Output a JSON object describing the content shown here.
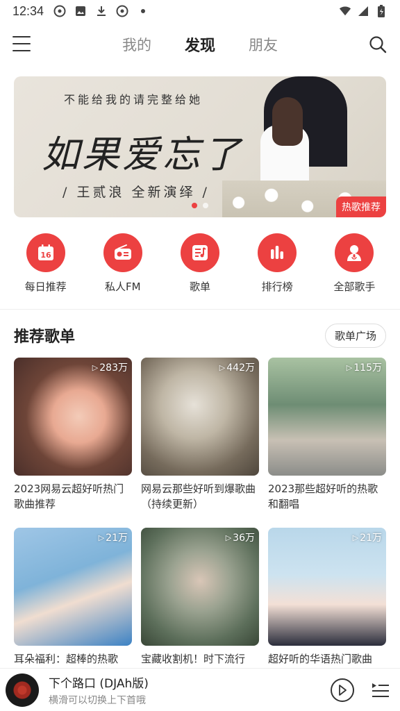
{
  "status_bar": {
    "time": "12:34",
    "left_icons": [
      "netease-icon",
      "image-icon",
      "download-icon",
      "netease-icon",
      "dot-icon"
    ],
    "right_icons": [
      "wifi-icon",
      "signal-icon",
      "battery-icon"
    ]
  },
  "nav": {
    "tabs": [
      {
        "label": "我的",
        "active": false
      },
      {
        "label": "发现",
        "active": true
      },
      {
        "label": "朋友",
        "active": false
      }
    ]
  },
  "banner": {
    "top_text": "不能给我的请完整给她",
    "title": "如果爱忘了",
    "subtitle": "/ 王贰浪  全新演绎 /",
    "tag": "热歌推荐",
    "dots": 2,
    "active_dot": 0
  },
  "quick_entries": [
    {
      "label": "每日推荐",
      "icon": "calendar-icon",
      "day": "16"
    },
    {
      "label": "私人FM",
      "icon": "radio-icon"
    },
    {
      "label": "歌单",
      "icon": "playlist-icon"
    },
    {
      "label": "排行榜",
      "icon": "chart-icon"
    },
    {
      "label": "全部歌手",
      "icon": "singer-icon"
    }
  ],
  "section": {
    "title": "推荐歌单",
    "more_label": "歌单广场"
  },
  "playlists": [
    {
      "count": "283万",
      "title": "2023网易云超好听热门歌曲推荐"
    },
    {
      "count": "442万",
      "title": "网易云那些好听到爆歌曲（持续更新）"
    },
    {
      "count": "115万",
      "title": "2023那些超好听的热歌和翻唱"
    },
    {
      "count": "21万",
      "title": "耳朵福利：超棒的热歌"
    },
    {
      "count": "36万",
      "title": "宝藏收割机！时下流行"
    },
    {
      "count": "21万",
      "title": "超好听的华语热门歌曲"
    }
  ],
  "player": {
    "song": "下个路口 (DJAh版)",
    "hint": "横滑可以切换上下首哦"
  },
  "colors": {
    "accent": "#ec4141"
  }
}
